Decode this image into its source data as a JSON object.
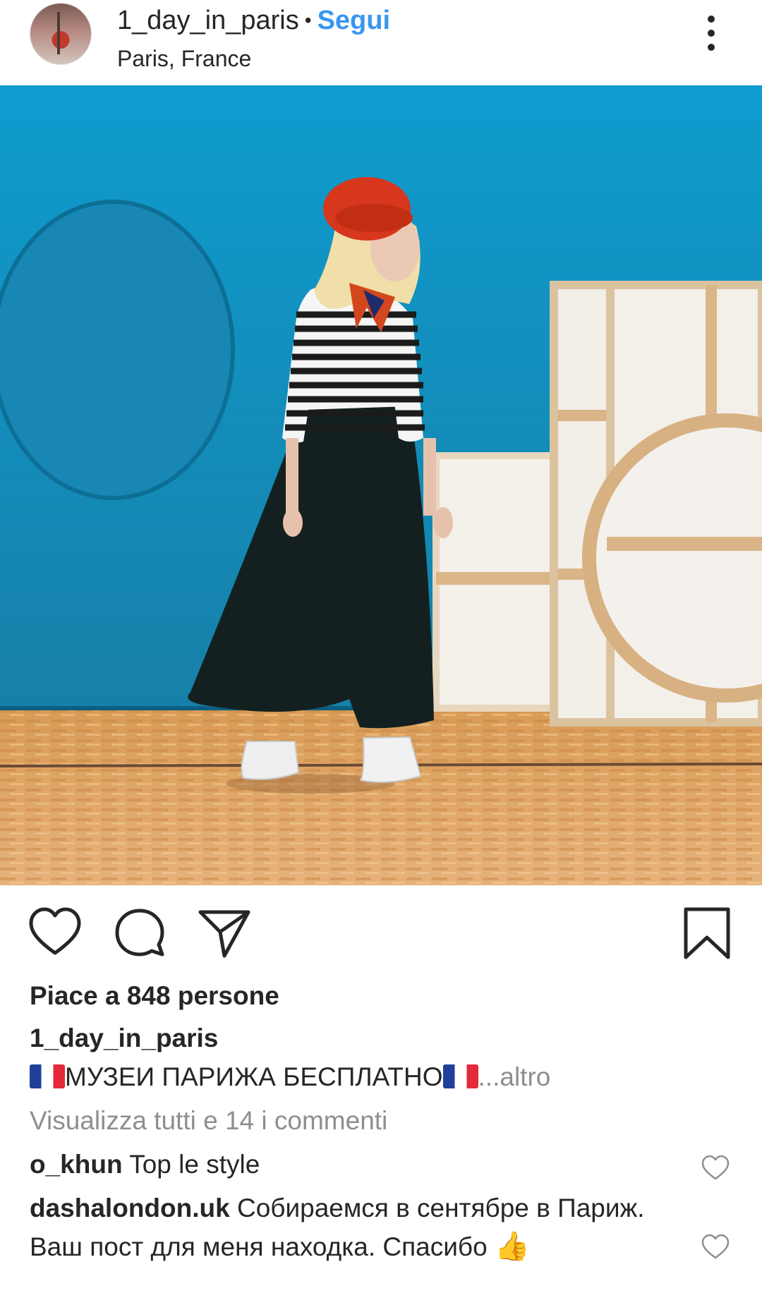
{
  "header": {
    "username": "1_day_in_paris",
    "separator": "•",
    "follow_label": "Segui",
    "location": "Paris, France"
  },
  "post": {
    "likes_text": "Piace a 848 persone",
    "caption_user": "1_day_in_paris",
    "caption_text": "МУЗЕИ ПАРИЖА БЕСПЛАТНО",
    "caption_more": "...altro",
    "view_all_comments": "Visualizza tutti e 14 i commenti"
  },
  "comments": [
    {
      "user": "o_khun",
      "text": "Top le style"
    },
    {
      "user": "dashalondon.uk",
      "text": "Собираемся в сентябре в Париж. Ваш пост для меня находка. Спасибо",
      "emoji": "👍"
    }
  ],
  "icons": {
    "more": "more-vertical-icon",
    "like": "heart-icon",
    "comment": "comment-bubble-icon",
    "share": "paper-plane-icon",
    "save": "bookmark-icon",
    "comment_like": "small-heart-icon"
  },
  "colors": {
    "link_blue": "#3897f0",
    "text": "#262626",
    "secondary": "#8e8e8e"
  }
}
